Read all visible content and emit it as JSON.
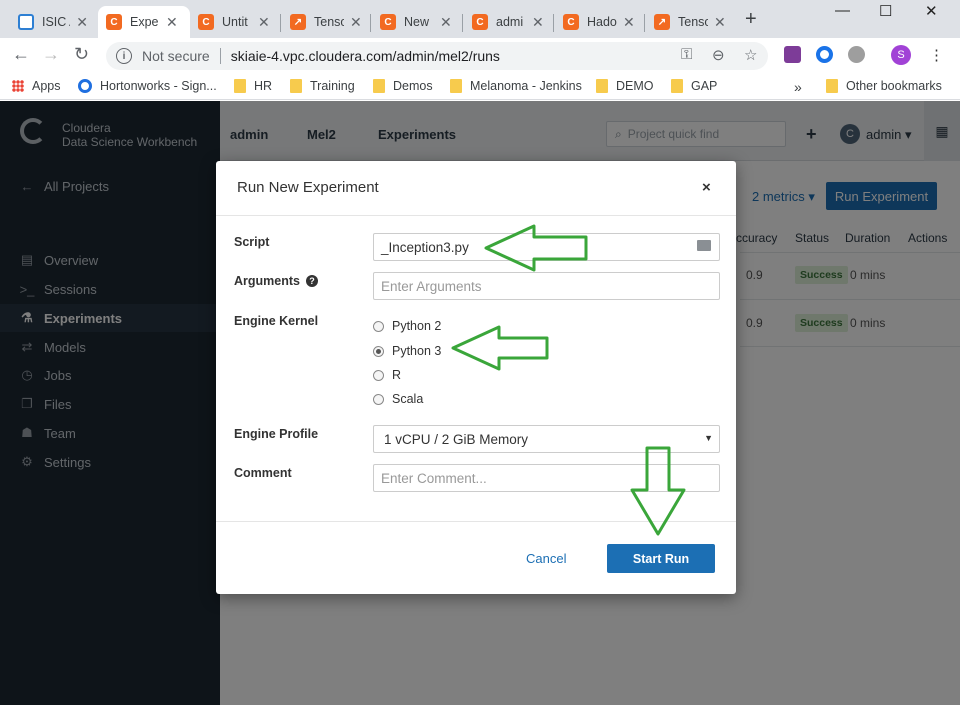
{
  "browser": {
    "tabs": [
      {
        "title": "ISIC A",
        "favicon": "isic-icon"
      },
      {
        "title": "Expe",
        "favicon": "cloudera-icon",
        "active": true
      },
      {
        "title": "Untit",
        "favicon": "cloudera-icon"
      },
      {
        "title": "Tenso",
        "favicon": "tensorboard-icon"
      },
      {
        "title": "New",
        "favicon": "cloudera-icon"
      },
      {
        "title": "admi",
        "favicon": "cloudera-icon"
      },
      {
        "title": "Hado",
        "favicon": "cloudera-icon"
      },
      {
        "title": "Tenso",
        "favicon": "tensorboard-icon"
      }
    ],
    "security_label": "Not secure",
    "url": "skiaie-4.vpc.cloudera.com/admin/mel2/runs",
    "profile_initial": "S",
    "bookmarks": [
      {
        "label": "Apps"
      },
      {
        "label": "Hortonworks - Sign..."
      },
      {
        "label": "HR"
      },
      {
        "label": "Training"
      },
      {
        "label": "Demos"
      },
      {
        "label": "Melanoma - Jenkins"
      },
      {
        "label": "DEMO"
      },
      {
        "label": "GAP"
      }
    ],
    "bookmarks_overflow": "»",
    "other_bookmarks": "Other bookmarks"
  },
  "app": {
    "brand_line1": "Cloudera",
    "brand_line2": "Data Science Workbench",
    "breadcrumbs": [
      "admin",
      "Mel2",
      "Experiments"
    ],
    "quick_find_placeholder": "Project quick find",
    "user_initial": "C",
    "user_name": "admin ▾",
    "sidebar": {
      "back": "All Projects",
      "items": [
        {
          "label": "Overview",
          "icon": "overview-icon"
        },
        {
          "label": "Sessions",
          "icon": "terminal-icon"
        },
        {
          "label": "Experiments",
          "icon": "flask-icon",
          "active": true
        },
        {
          "label": "Models",
          "icon": "arrows-icon"
        },
        {
          "label": "Jobs",
          "icon": "clock-icon"
        },
        {
          "label": "Files",
          "icon": "files-icon"
        },
        {
          "label": "Team",
          "icon": "team-icon"
        },
        {
          "label": "Settings",
          "icon": "gear-icon"
        }
      ]
    },
    "metrics_label": "2 metrics ▾",
    "run_experiment_label": "Run Experiment",
    "table": {
      "headers": [
        "ccuracy",
        "Status",
        "Duration",
        "Actions"
      ],
      "rows": [
        {
          "accuracy": "0.9",
          "status": "Success",
          "duration": "0 mins"
        },
        {
          "accuracy": "0.9",
          "status": "Success",
          "duration": "0 mins"
        }
      ]
    }
  },
  "modal": {
    "title": "Run New Experiment",
    "close": "×",
    "script_label": "Script",
    "script_value": "_Inception3.py",
    "arguments_label": "Arguments",
    "arguments_placeholder": "Enter Arguments",
    "kernel_label": "Engine Kernel",
    "kernels": [
      {
        "label": "Python 2",
        "selected": false
      },
      {
        "label": "Python 3",
        "selected": true
      },
      {
        "label": "R",
        "selected": false
      },
      {
        "label": "Scala",
        "selected": false
      }
    ],
    "profile_label": "Engine Profile",
    "profile_value": "1 vCPU / 2 GiB Memory",
    "comment_label": "Comment",
    "comment_placeholder": "Enter Comment...",
    "cancel_label": "Cancel",
    "start_label": "Start Run"
  },
  "colors": {
    "annotation_arrow": "#3aa63a",
    "primary": "#1c6fb4",
    "sidebar_bg": "#1d2833"
  }
}
